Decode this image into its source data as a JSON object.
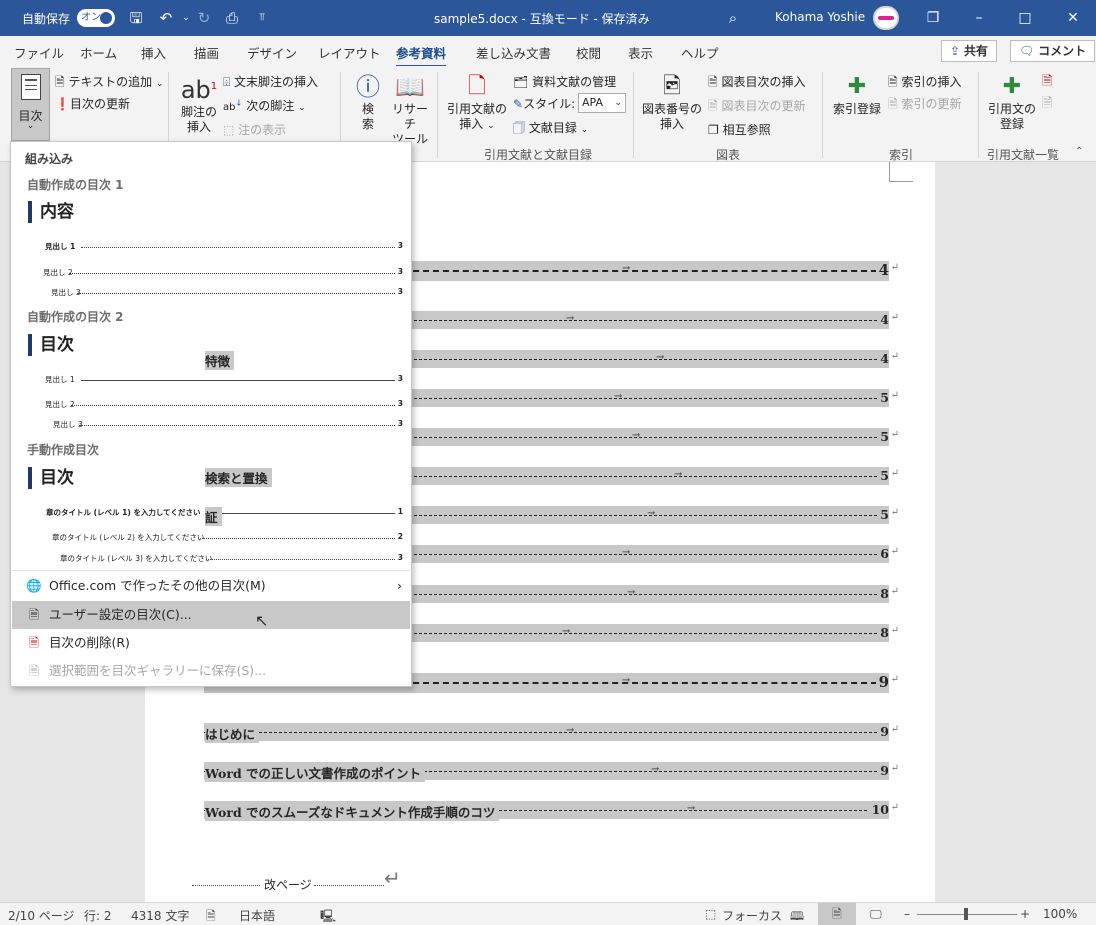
{
  "titlebar": {
    "autosave_label": "自動保存",
    "autosave_state": "オン",
    "doc_title": "sample5.docx  -  互換モード  -  保存済み",
    "user_name": "Kohama Yoshie"
  },
  "tabs": [
    "ファイル",
    "ホーム",
    "挿入",
    "描画",
    "デザイン",
    "レイアウト",
    "参考資料",
    "差し込み文書",
    "校閲",
    "表示",
    "ヘルプ"
  ],
  "active_tab": "参考資料",
  "share_label": "共有",
  "comment_label": "コメント",
  "ribbon": {
    "toc_button": "目次",
    "add_text": "テキストの追加",
    "update_toc": "目次の更新",
    "insert_footnote_1": "脚注の",
    "insert_footnote_2": "挿入",
    "insert_endnote": "文末脚注の挿入",
    "next_footnote": "次の脚注",
    "show_notes": "注の表示",
    "search_1": "検",
    "search_2": "索",
    "researcher_1": "リサーチ",
    "researcher_2": "ツール",
    "insert_citation_1": "引用文献の",
    "insert_citation_2": "挿入",
    "manage_sources": "資料文献の管理",
    "style_label": "スタイル:",
    "style_value": "APA",
    "bibliography": "文献目録",
    "group_citations": "引用文献と文献目録",
    "insert_caption_1": "図表番号の",
    "insert_caption_2": "挿入",
    "insert_tof": "図表目次の挿入",
    "update_tof": "図表目次の更新",
    "cross_reference": "相互参照",
    "group_captions": "図表",
    "mark_entry": "索引登録",
    "insert_index": "索引の挿入",
    "update_index": "索引の更新",
    "group_index": "索引",
    "mark_citation_1": "引用文の",
    "mark_citation_2": "登録",
    "group_toa": "引用文献一覧"
  },
  "dropdown": {
    "builtin": "組み込み",
    "auto1_title": "自動作成の目次 1",
    "auto1_heading": "内容",
    "auto2_title": "自動作成の目次 2",
    "auto2_heading": "目次",
    "manual_title": "手動作成目次",
    "manual_heading": "目次",
    "preview_h1": "見出し 1",
    "preview_h2": "見出し 2",
    "preview_h3": "見出し 3",
    "preview_page": "3",
    "manual_l1": "章のタイトル (レベル 1) を入力してください",
    "manual_l2": "章のタイトル (レベル 2) を入力してください",
    "manual_l3": "章のタイトル (レベル 3) を入力してください",
    "manual_p1": "1",
    "manual_p2": "2",
    "manual_p3": "3",
    "more_office": "Office.com で作ったその他の目次(M)",
    "custom_toc": "ユーザー設定の目次(C)...",
    "remove_toc": "目次の削除(R)",
    "save_selection": "選択範囲を目次ギャラリーに保存(S)..."
  },
  "document": {
    "toc_entries": [
      {
        "label": "",
        "page": "4"
      },
      {
        "label": "",
        "page": "4"
      },
      {
        "label": "特徴",
        "page": "4"
      },
      {
        "label": "",
        "page": "5"
      },
      {
        "label": "",
        "page": "5"
      },
      {
        "label": "検索と置換",
        "page": "5"
      },
      {
        "label": "証",
        "page": "5"
      },
      {
        "label": "",
        "page": "6"
      },
      {
        "label": "",
        "page": "8"
      },
      {
        "label": "",
        "page": "8"
      },
      {
        "label": "",
        "page": "9"
      },
      {
        "label": "はじめに",
        "page": "9"
      },
      {
        "label": "Word での正しい文書作成のポイント",
        "page": "9"
      },
      {
        "label": "Word でのスムーズなドキュメント作成手順のコツ",
        "page": "10"
      }
    ],
    "page_break": "改ページ"
  },
  "status": {
    "page": "2/10 ページ",
    "line": "行: 2",
    "words": "4318 文字",
    "language": "日本語",
    "focus": "フォーカス",
    "zoom": "100%"
  },
  "colors": {
    "accent": "#2b579a",
    "highlight": "#c8c8c8"
  }
}
